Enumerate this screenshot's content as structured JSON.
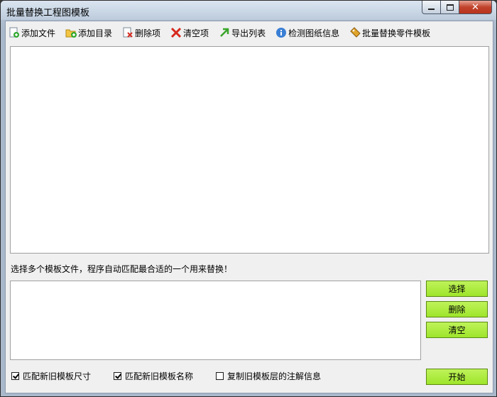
{
  "window": {
    "title": "批量替换工程图模板"
  },
  "toolbar": {
    "add_file": "添加文件",
    "add_dir": "添加目录",
    "delete_item": "删除项",
    "clear_items": "清空项",
    "export_list": "导出列表",
    "check_info": "检测图纸信息",
    "batch_part": "批量替换零件模板"
  },
  "template": {
    "hint": "选择多个模板文件，程序自动匹配最合适的一个用来替换！",
    "select": "选择",
    "delete": "删除",
    "clear": "清空"
  },
  "options": {
    "match_size": {
      "label": "匹配新旧模板尺寸",
      "checked": true
    },
    "match_name": {
      "label": "匹配新旧模板名称",
      "checked": true
    },
    "copy_notes": {
      "label": "复制旧模板层的注解信息",
      "checked": false
    }
  },
  "start": "开始",
  "colors": {
    "accent_button": "#a8ea36",
    "close_button": "#c0432c"
  }
}
